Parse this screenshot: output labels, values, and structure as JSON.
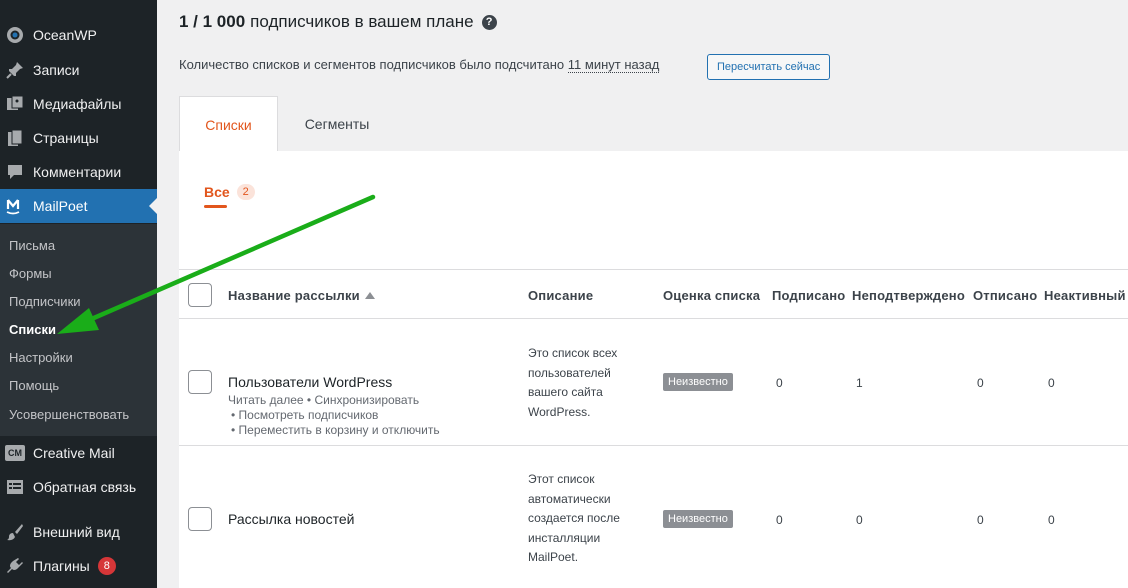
{
  "sidebar": {
    "items": [
      {
        "label": "OceanWP",
        "icon": "oceanwp-icon"
      },
      {
        "label": "Записи",
        "icon": "pin-icon"
      },
      {
        "label": "Медиафайлы",
        "icon": "media-icon"
      },
      {
        "label": "Страницы",
        "icon": "pages-icon"
      },
      {
        "label": "Комментарии",
        "icon": "comment-icon"
      },
      {
        "label": "MailPoet",
        "icon": "mailpoet-icon"
      }
    ],
    "submenu": [
      "Письма",
      "Формы",
      "Подписчики",
      "Списки",
      "Настройки",
      "Помощь",
      "Усовершенствовать"
    ],
    "bottom": [
      {
        "label": "Creative Mail",
        "icon": "creative-mail-icon",
        "icon_text": "CM"
      },
      {
        "label": "Обратная связь",
        "icon": "feedback-icon"
      },
      {
        "label": "Внешний вид",
        "icon": "brush-icon"
      },
      {
        "label": "Плагины",
        "icon": "plugin-icon",
        "badge": "8"
      }
    ]
  },
  "header": {
    "plan_count": "1 / 1 000",
    "plan_text": "подписчиков в вашем плане",
    "help_icon": "?",
    "count_text": "Количество списков и сегментов подписчиков было подсчитано",
    "count_ago": "11 минут назад",
    "recount_button": "Пересчитать сейчас"
  },
  "tabs": {
    "lists": "Списки",
    "segments": "Сегменты"
  },
  "filter": {
    "label": "Все",
    "count": "2"
  },
  "table": {
    "columns": [
      "Название рассылки",
      "Описание",
      "Оценка списка",
      "Подписано",
      "Неподтверждено",
      "Отписано",
      "Неактивный"
    ],
    "rows": [
      {
        "title": "Пользователи WordPress",
        "actions": [
          "Читать далее • Синхронизировать",
          "• Посмотреть подписчиков",
          "• Переместить в корзину и отключить"
        ],
        "description": [
          "Это список всех",
          "пользователей",
          "вашего сайта",
          "WordPress."
        ],
        "score": "Неизвестно",
        "subscribed": "0",
        "unconfirmed": "1",
        "unsubscribed": "0",
        "inactive": "0"
      },
      {
        "title": "Рассылка новостей",
        "actions": [],
        "description": [
          "Этот список",
          "автоматически",
          "создается после",
          "инсталляции",
          "MailPoet."
        ],
        "score": "Неизвестно",
        "subscribed": "0",
        "unconfirmed": "0",
        "unsubscribed": "0",
        "inactive": "0"
      }
    ]
  },
  "colors": {
    "sidebar_bg": "#1d2327",
    "active_menu": "#2271b1",
    "accent_orange": "#e2561d",
    "arrow_green": "#1aad19"
  }
}
